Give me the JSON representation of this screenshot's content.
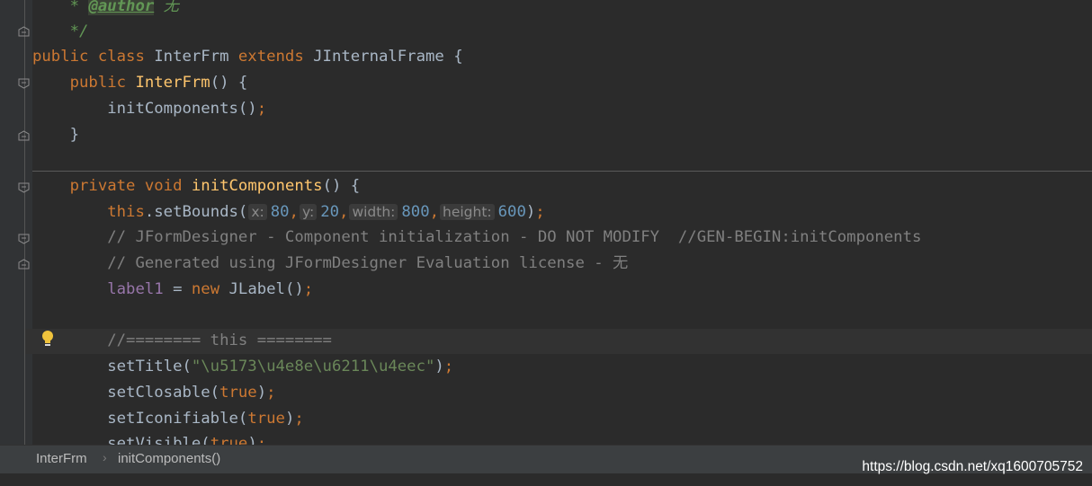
{
  "code": {
    "l0": {
      "prefix": "* ",
      "tag": "@author",
      "suffix": " 无"
    },
    "l1": "*/",
    "l2": {
      "kw1": "public class ",
      "name": "InterFrm",
      "kw2": " extends ",
      "parent": "JInternalFrame",
      "brace": " {"
    },
    "l3": {
      "kw": "public ",
      "fn": "InterFrm",
      "rest": "() {"
    },
    "l4": {
      "call": "initComponents()",
      "semi": ";"
    },
    "l5": "}",
    "l6": {
      "kw": "private void ",
      "fn": "initComponents",
      "rest": "() {"
    },
    "l7": {
      "this_kw": "this",
      "method": ".setBounds(",
      "hint_x": "x:",
      "val_x": "80",
      "hint_y": "y:",
      "val_y": "20",
      "hint_w": "width:",
      "val_w": "800",
      "hint_h": "height:",
      "val_h": "600",
      "comma": ",",
      "close": ")",
      "semi": ";"
    },
    "l8": "// JFormDesigner - Component initialization - DO NOT MODIFY  //GEN-BEGIN:initComponents",
    "l9": "// Generated using JFormDesigner Evaluation license - 无",
    "l10": {
      "field": "label1",
      "eq": " = ",
      "kw": "new ",
      "cls": "JLabel()",
      "semi": ";"
    },
    "l11": "//======== this ========",
    "l12": {
      "call": "setTitle(",
      "str": "\"\\u5173\\u4e8e\\u6211\\u4eec\"",
      "close": ")",
      "semi": ";"
    },
    "l13": {
      "call": "setClosable(",
      "kw": "true",
      "close": ")",
      "semi": ";"
    },
    "l14": {
      "call": "setIconifiable(",
      "kw": "true",
      "close": ")",
      "semi": ";"
    },
    "l15": {
      "call": "setVisible(",
      "kw": "true",
      "close": ")",
      "semi": ";"
    }
  },
  "breadcrumb": {
    "class": "InterFrm",
    "separator": "›",
    "method": "initComponents()"
  },
  "watermark": "https://blog.csdn.net/xq1600705752",
  "icons": [
    "fold-marker-icon",
    "intention-bulb-icon"
  ],
  "colors": {
    "background": "#2b2b2b",
    "keyword": "#cc7832",
    "function": "#ffc66d",
    "number": "#6897bb",
    "string": "#6a8759",
    "comment": "#808080",
    "field": "#9876aa"
  }
}
